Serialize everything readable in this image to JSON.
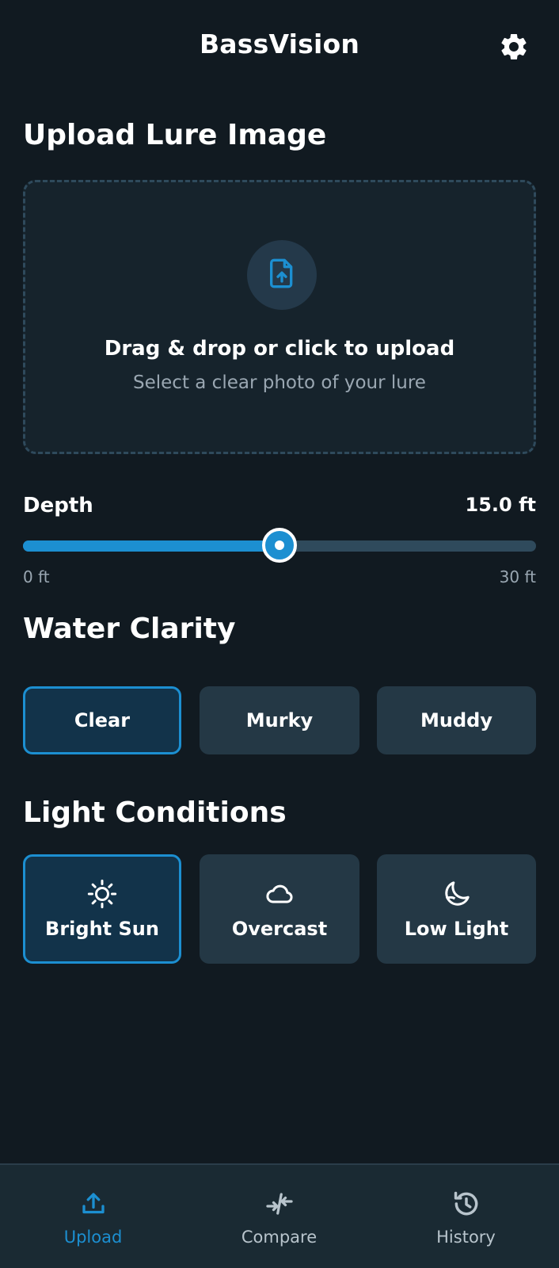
{
  "header": {
    "title": "BassVision",
    "settings_icon": "gear-icon"
  },
  "upload": {
    "section_title": "Upload Lure Image",
    "icon": "file-upload-icon",
    "primary_text": "Drag & drop or click to upload",
    "secondary_text": "Select a clear photo of your lure"
  },
  "depth": {
    "label": "Depth",
    "value_text": "15.0 ft",
    "value": 15.0,
    "min_label": "0 ft",
    "max_label": "30 ft",
    "min": 0,
    "max": 30
  },
  "water_clarity": {
    "section_title": "Water Clarity",
    "options": [
      {
        "label": "Clear",
        "selected": true
      },
      {
        "label": "Murky",
        "selected": false
      },
      {
        "label": "Muddy",
        "selected": false
      }
    ]
  },
  "light_conditions": {
    "section_title": "Light Conditions",
    "options": [
      {
        "label": "Bright Sun",
        "icon": "sun-icon",
        "selected": true
      },
      {
        "label": "Overcast",
        "icon": "cloud-icon",
        "selected": false
      },
      {
        "label": "Low Light",
        "icon": "moon-icon",
        "selected": false
      }
    ]
  },
  "bottom_nav": {
    "items": [
      {
        "label": "Upload",
        "icon": "upload-icon",
        "active": true
      },
      {
        "label": "Compare",
        "icon": "compare-arrows-icon",
        "active": false
      },
      {
        "label": "History",
        "icon": "history-icon",
        "active": false
      }
    ]
  },
  "colors": {
    "accent": "#1c8fd1",
    "background": "#111a21",
    "card": "#243845",
    "selected_card": "#12334a",
    "muted_text": "#9aa7b2"
  }
}
